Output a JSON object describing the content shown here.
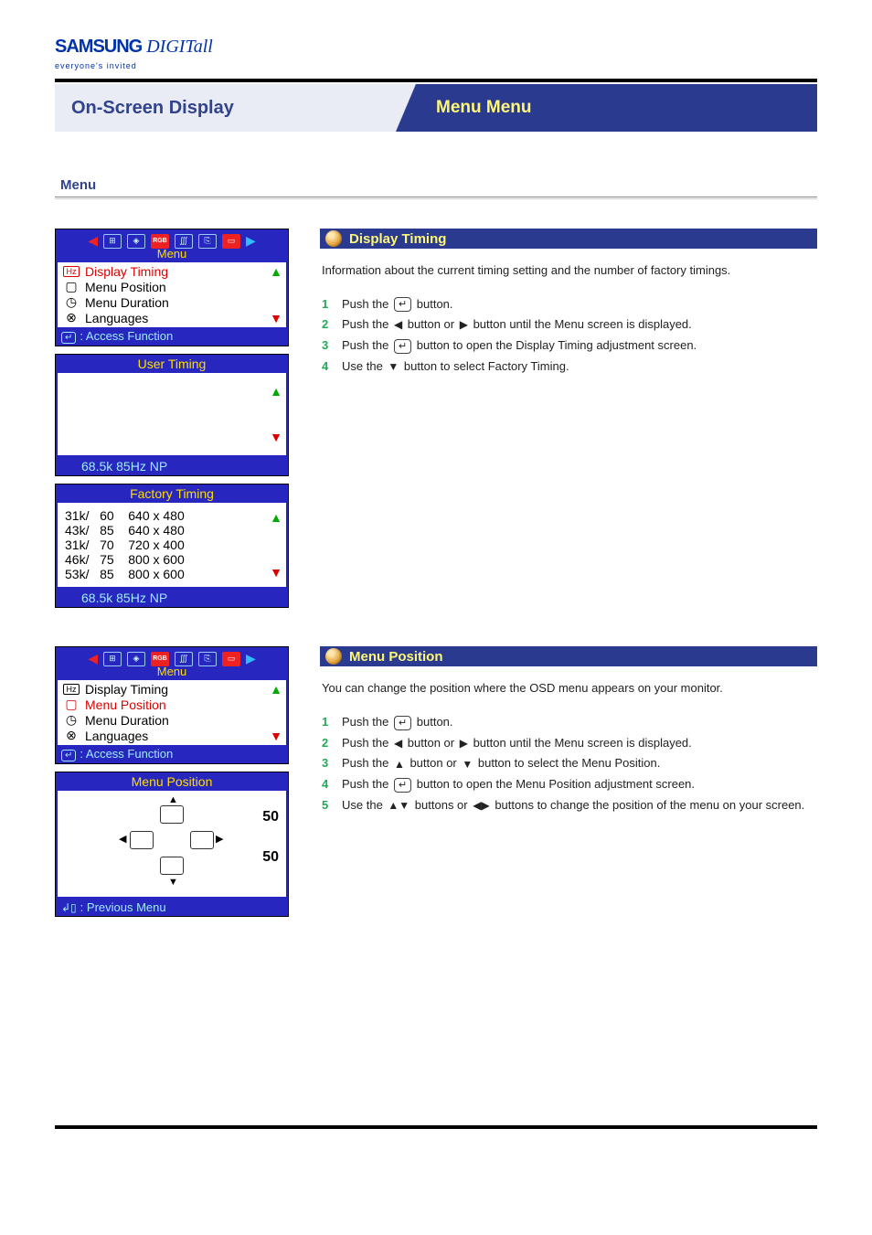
{
  "header": {
    "brand_a": "SAMSUNG",
    "brand_b": " DIGITall",
    "tagline": "everyone's invited",
    "section_title": "On-Screen Display",
    "section_sub": "Menu Menu",
    "category_label": "Menu"
  },
  "menu": {
    "title": "Menu",
    "items": [
      "Display Timing",
      "Menu Position",
      "Menu Duration",
      "Languages"
    ],
    "access_fn": ": Access Function",
    "prev_menu": ": Previous Menu"
  },
  "display_timing": {
    "bar_title": "Display Timing",
    "desc": "Information about the current timing setting and the number of factory timings.",
    "user_title": "User Timing",
    "factory_title": "Factory Timing",
    "factory_rows": [
      "31k/   60    640 x 480",
      "43k/   85    640 x 480",
      "31k/   70    720 x 400",
      "46k/   75    800 x 600",
      "53k/   85    800 x 600"
    ],
    "status": "68.5k     85Hz   NP",
    "steps": [
      {
        "n": "1",
        "t": "Push the "
      },
      {
        "enter": true,
        "t2": " button."
      },
      {
        "n": "2",
        "t": "Push the ◀ button or ▶ button until the Menu screen is displayed."
      },
      {
        "n": "3",
        "t": "Push the ",
        "enter": true,
        "t2": " button to open the Display Timing adjustment screen."
      },
      {
        "n": "4",
        "t": "Use the ▼ button to select Factory Timing."
      }
    ]
  },
  "menu_position": {
    "bar_title": "Menu Position",
    "desc": "You can change the position where the OSD menu appears on your monitor.",
    "panel_title": "Menu Position",
    "value_h": "50",
    "value_v": "50",
    "steps": [
      {
        "n": "1",
        "t": "Push the ",
        "enter": true,
        "t2": " button."
      },
      {
        "n": "2",
        "t": "Push the ◀ button or ▶ button until the Menu screen is displayed."
      },
      {
        "n": "3",
        "t": "Push the ▲ button or ▼ button to select the Menu Position."
      },
      {
        "n": "4",
        "t": "Push the ",
        "enter": true,
        "t2": " button to open the Menu Position adjustment screen."
      },
      {
        "n": "5",
        "t": "Use the ▲▼ buttons or ◀▶ buttons to change the position of the menu on your screen."
      }
    ]
  }
}
